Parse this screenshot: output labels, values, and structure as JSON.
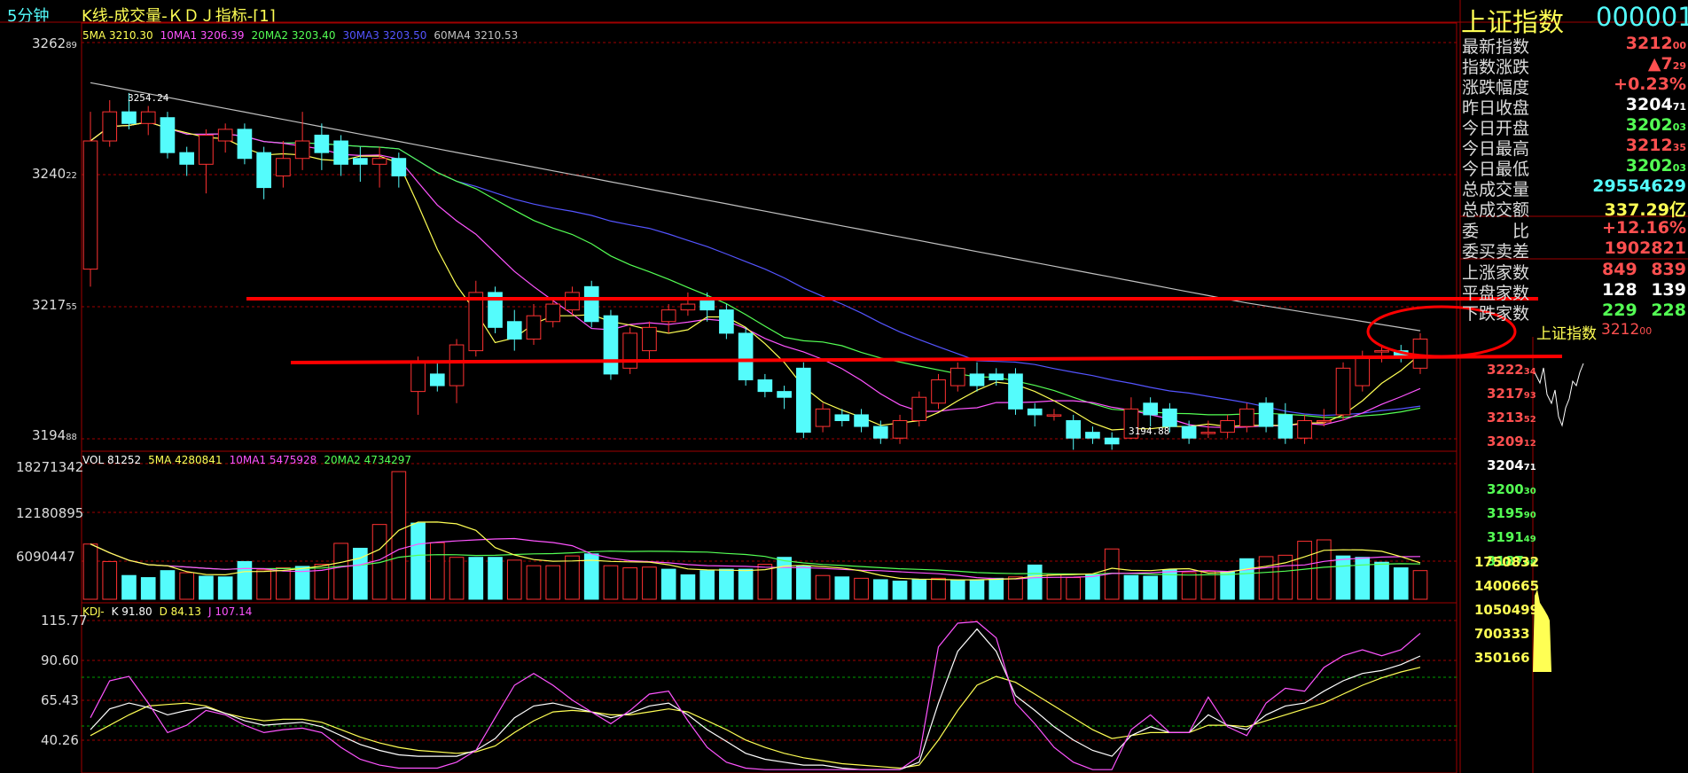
{
  "header": {
    "period": "5分钟",
    "title": "K线-成交量-ＫＤＪ指标-[1]"
  },
  "colors": {
    "up": "#ff3232",
    "down": "#54fcfc",
    "ma5": "#ffff54",
    "ma10": "#ff54ff",
    "ma20": "#54ff54",
    "ma30": "#5454ff",
    "ma60": "#c0c0c0",
    "grid": "#a00000",
    "annotation": "#ff0000"
  },
  "price_panel": {
    "legend": [
      {
        "label": "5MA 3210.30",
        "color": "#ffff54"
      },
      {
        "label": "10MA1 3206.39",
        "color": "#ff54ff"
      },
      {
        "label": "20MA2 3203.40",
        "color": "#54ff54"
      },
      {
        "label": "30MA3 3203.50",
        "color": "#5454ff"
      },
      {
        "label": "60MA4 3210.53",
        "color": "#c0c0c0"
      }
    ],
    "axis_labels": [
      {
        "main": "3262",
        "sub": "89"
      },
      {
        "main": "3240",
        "sub": "22"
      },
      {
        "main": "3217",
        "sub": "55"
      },
      {
        "main": "3194",
        "sub": "88"
      }
    ],
    "high_note": "3254.24",
    "low_note": "3194.88"
  },
  "volume_panel": {
    "legend": [
      {
        "label": "VOL 81252",
        "color": "#ffffff"
      },
      {
        "label": "5MA 4280841",
        "color": "#ffff54"
      },
      {
        "label": "10MA1 5475928",
        "color": "#ff54ff"
      },
      {
        "label": "20MA2 4734297",
        "color": "#54ff54"
      }
    ],
    "axis_labels": [
      "18271342",
      "12180895",
      "6090447"
    ]
  },
  "kdj_panel": {
    "legend": [
      {
        "label": "KDJ-",
        "color": "#ffff54"
      },
      {
        "label": "K 91.80",
        "color": "#ffffff"
      },
      {
        "label": "D 84.13",
        "color": "#ffff54"
      },
      {
        "label": "J 107.14",
        "color": "#ff54ff"
      }
    ],
    "axis_labels": [
      "115.77",
      "90.60",
      "65.43",
      "40.26"
    ]
  },
  "quote": {
    "name": "上证指数",
    "code": "000001",
    "rows": [
      {
        "label": "最新指数",
        "value": "3212",
        "sub": "00",
        "color": "#ff5050"
      },
      {
        "label": "指数涨跌",
        "value": "▲7",
        "sub": "29",
        "color": "#ff5050"
      },
      {
        "label": "涨跌幅度",
        "value": "+0.23%",
        "sub": "",
        "color": "#ff5050"
      },
      {
        "label": "昨日收盘",
        "value": "3204",
        "sub": "71",
        "color": "#ffffff"
      },
      {
        "label": "今日开盘",
        "value": "3202",
        "sub": "03",
        "color": "#54ff54"
      },
      {
        "label": "今日最高",
        "value": "3212",
        "sub": "35",
        "color": "#ff5050"
      },
      {
        "label": "今日最低",
        "value": "3202",
        "sub": "03",
        "color": "#54ff54"
      },
      {
        "label": "总成交量",
        "value": "29554629",
        "sub": "",
        "color": "#54fcfc"
      },
      {
        "label": "总成交额",
        "value": "337.29亿",
        "sub": "",
        "color": "#ffff54"
      }
    ],
    "ratio_rows": [
      {
        "label": "委　　比",
        "value": "+12.16%",
        "color": "#ff5050"
      },
      {
        "label": "委买卖差",
        "value": "1902821",
        "color": "#ff5050"
      }
    ],
    "breadth_rows": [
      {
        "label": "上涨家数",
        "v1": "849",
        "v2": "839",
        "color": "#ff5050"
      },
      {
        "label": "平盘家数",
        "v1": "128",
        "v2": "139",
        "color": "#ffffff"
      },
      {
        "label": "下跌家数",
        "v1": "229",
        "v2": "228",
        "color": "#54ff54"
      }
    ]
  },
  "mini_chart": {
    "title": "上证指数",
    "price": "3212",
    "price_sub": "00",
    "price_labels": [
      {
        "main": "3222",
        "sub": "34",
        "color": "#ff5050"
      },
      {
        "main": "3217",
        "sub": "93",
        "color": "#ff5050"
      },
      {
        "main": "3213",
        "sub": "52",
        "color": "#ff5050"
      },
      {
        "main": "3209",
        "sub": "12",
        "color": "#ff5050"
      },
      {
        "main": "3204",
        "sub": "71",
        "color": "#ffffff"
      },
      {
        "main": "3200",
        "sub": "30",
        "color": "#54ff54"
      },
      {
        "main": "3195",
        "sub": "90",
        "color": "#54ff54"
      },
      {
        "main": "3191",
        "sub": "49",
        "color": "#54ff54"
      },
      {
        "main": "3187",
        "sub": "08",
        "color": "#54ff54"
      }
    ],
    "volume_labels": [
      "1750832",
      "1400665",
      "1050499",
      "700333",
      "350166"
    ]
  },
  "chart_data": {
    "type": "candlestick",
    "price_ylim": [
      3194.88,
      3262.89
    ],
    "candles": [
      [
        3224,
        3246,
        3221,
        3251
      ],
      [
        3246,
        3251,
        3245,
        3253
      ],
      [
        3251,
        3249,
        3248,
        3254.24
      ],
      [
        3249,
        3251,
        3247,
        3252
      ],
      [
        3250,
        3244,
        3243,
        3251
      ],
      [
        3244,
        3242,
        3240,
        3245
      ],
      [
        3242,
        3247,
        3237,
        3248
      ],
      [
        3246,
        3248,
        3244,
        3249
      ],
      [
        3248,
        3243,
        3242,
        3249
      ],
      [
        3244,
        3238,
        3236,
        3245
      ],
      [
        3240,
        3243,
        3238,
        3246
      ],
      [
        3243,
        3246,
        3241,
        3251
      ],
      [
        3247,
        3244,
        3241,
        3249
      ],
      [
        3246,
        3242,
        3240,
        3247
      ],
      [
        3243,
        3242,
        3239,
        3245
      ],
      [
        3242,
        3243,
        3238,
        3245
      ],
      [
        3243,
        3240,
        3238,
        3244
      ],
      [
        3203,
        3208,
        3199,
        3209
      ],
      [
        3206,
        3204,
        3203,
        3208
      ],
      [
        3204,
        3211,
        3201,
        3212
      ],
      [
        3210,
        3220,
        3209,
        3222
      ],
      [
        3220,
        3214,
        3213,
        3221
      ],
      [
        3215,
        3212,
        3210,
        3217
      ],
      [
        3212,
        3216,
        3211,
        3218
      ],
      [
        3215,
        3218,
        3214,
        3219
      ],
      [
        3217,
        3220,
        3216,
        3221
      ],
      [
        3221,
        3215,
        3214,
        3222
      ],
      [
        3216,
        3206,
        3205,
        3217
      ],
      [
        3207,
        3213,
        3206,
        3214
      ],
      [
        3210,
        3214,
        3208,
        3215
      ],
      [
        3215,
        3217,
        3213,
        3218
      ],
      [
        3217,
        3218,
        3216,
        3220
      ],
      [
        3219,
        3217,
        3215,
        3220
      ],
      [
        3217,
        3213,
        3212,
        3218
      ],
      [
        3213,
        3205,
        3204,
        3214
      ],
      [
        3205,
        3203,
        3202,
        3206
      ],
      [
        3203,
        3202,
        3200,
        3204
      ],
      [
        3207,
        3196,
        3195,
        3208
      ],
      [
        3197,
        3200,
        3196,
        3201
      ],
      [
        3199,
        3198,
        3197,
        3200
      ],
      [
        3199,
        3197,
        3196,
        3200
      ],
      [
        3197,
        3195,
        3194,
        3198
      ],
      [
        3195,
        3198,
        3194,
        3199
      ],
      [
        3198,
        3202,
        3197,
        3203
      ],
      [
        3201,
        3205,
        3200,
        3206
      ],
      [
        3204,
        3207,
        3203,
        3208
      ],
      [
        3206,
        3204,
        3203,
        3208
      ],
      [
        3206,
        3205,
        3204,
        3207
      ],
      [
        3206,
        3200,
        3199,
        3207
      ],
      [
        3200,
        3199,
        3197,
        3201
      ],
      [
        3199,
        3199,
        3198,
        3200
      ],
      [
        3198,
        3195,
        3193,
        3199
      ],
      [
        3196,
        3195,
        3194,
        3197
      ],
      [
        3195,
        3194,
        3193,
        3196
      ],
      [
        3195,
        3200,
        3194.88,
        3202
      ],
      [
        3201,
        3199,
        3197,
        3202
      ],
      [
        3200,
        3197,
        3196,
        3201
      ],
      [
        3197,
        3195,
        3194,
        3198
      ],
      [
        3196,
        3196,
        3195,
        3198
      ],
      [
        3196,
        3198,
        3195,
        3199
      ],
      [
        3197,
        3200,
        3196,
        3201
      ],
      [
        3201,
        3197,
        3196,
        3202
      ],
      [
        3199,
        3195,
        3194,
        3201
      ],
      [
        3195,
        3198,
        3194,
        3199
      ],
      [
        3198,
        3198,
        3197,
        3200
      ],
      [
        3199,
        3207,
        3198,
        3208
      ],
      [
        3204,
        3209,
        3203,
        3210
      ],
      [
        3210,
        3210,
        3208,
        3211
      ],
      [
        3210,
        3209,
        3208,
        3211
      ],
      [
        3207,
        3212,
        3206,
        3213
      ]
    ],
    "volume_ylim": [
      0,
      18271342
    ],
    "volume": [
      [
        7.9,
        0
      ],
      [
        5.4,
        0
      ],
      [
        3.4,
        1
      ],
      [
        3.1,
        1
      ],
      [
        4.1,
        1
      ],
      [
        3.8,
        0
      ],
      [
        3.3,
        1
      ],
      [
        3.2,
        1
      ],
      [
        5.4,
        1
      ],
      [
        4.2,
        0
      ],
      [
        4.5,
        0
      ],
      [
        4.7,
        1
      ],
      [
        5.0,
        0
      ],
      [
        8.0,
        0
      ],
      [
        7.3,
        1
      ],
      [
        10.7,
        0
      ],
      [
        18.27,
        0
      ],
      [
        10.9,
        1
      ],
      [
        8.1,
        0
      ],
      [
        6.0,
        0
      ],
      [
        6.0,
        1
      ],
      [
        6.0,
        1
      ],
      [
        5.6,
        0
      ],
      [
        4.8,
        0
      ],
      [
        4.8,
        0
      ],
      [
        6.2,
        0
      ],
      [
        6.5,
        1
      ],
      [
        4.8,
        0
      ],
      [
        4.5,
        0
      ],
      [
        4.6,
        0
      ],
      [
        4.3,
        1
      ],
      [
        3.5,
        1
      ],
      [
        4.1,
        1
      ],
      [
        4.3,
        1
      ],
      [
        4.3,
        1
      ],
      [
        5.0,
        0
      ],
      [
        6.0,
        1
      ],
      [
        4.7,
        1
      ],
      [
        3.4,
        0
      ],
      [
        3.2,
        1
      ],
      [
        3.0,
        0
      ],
      [
        2.8,
        1
      ],
      [
        2.6,
        1
      ],
      [
        2.8,
        1
      ],
      [
        3.0,
        0
      ],
      [
        2.7,
        1
      ],
      [
        2.8,
        1
      ],
      [
        3.0,
        1
      ],
      [
        3.2,
        0
      ],
      [
        4.9,
        1
      ],
      [
        3.5,
        0
      ],
      [
        3.1,
        0
      ],
      [
        3.5,
        1
      ],
      [
        7.2,
        0
      ],
      [
        3.4,
        1
      ],
      [
        3.3,
        1
      ],
      [
        4.2,
        1
      ],
      [
        3.8,
        0
      ],
      [
        4.0,
        0
      ],
      [
        3.9,
        1
      ],
      [
        5.8,
        1
      ],
      [
        6.1,
        0
      ],
      [
        6.3,
        0
      ],
      [
        8.3,
        0
      ],
      [
        8.5,
        0
      ],
      [
        6.2,
        1
      ],
      [
        6.0,
        1
      ],
      [
        5.3,
        1
      ],
      [
        4.5,
        1
      ],
      [
        4.1,
        0
      ]
    ],
    "kdj_ylim": [
      15.09,
      115.77
    ],
    "k": [
      42,
      56,
      60,
      57,
      52,
      55,
      57,
      53,
      48,
      45,
      46,
      47,
      44,
      38,
      32,
      28,
      25,
      24,
      24,
      24,
      28,
      36,
      50,
      58,
      60,
      57,
      54,
      50,
      53,
      58,
      60,
      52,
      42,
      34,
      26,
      22,
      20,
      18,
      18,
      16,
      15,
      15,
      15,
      20,
      60,
      95,
      110,
      95,
      65,
      55,
      44,
      35,
      28,
      24,
      38,
      44,
      40,
      40,
      52,
      45,
      42,
      52,
      58,
      60,
      68,
      75,
      80,
      82,
      86,
      91.8
    ],
    "d": [
      38,
      45,
      52,
      58,
      59,
      60,
      58,
      53,
      50,
      48,
      49,
      49,
      47,
      42,
      37,
      33,
      30,
      28,
      27,
      26,
      27,
      31,
      40,
      48,
      54,
      55,
      54,
      52,
      52,
      54,
      56,
      54,
      48,
      42,
      35,
      30,
      26,
      23,
      21,
      19,
      18,
      17,
      16,
      18,
      35,
      55,
      72,
      78,
      74,
      66,
      58,
      50,
      42,
      36,
      38,
      40,
      40,
      40,
      45,
      45,
      44,
      48,
      52,
      56,
      60,
      66,
      72,
      77,
      81,
      84.13
    ],
    "j": [
      50,
      75,
      78,
      60,
      40,
      45,
      55,
      52,
      45,
      40,
      42,
      43,
      40,
      30,
      22,
      18,
      16,
      16,
      16,
      20,
      28,
      50,
      72,
      80,
      72,
      62,
      54,
      46,
      55,
      66,
      68,
      48,
      30,
      20,
      16,
      15,
      15,
      15,
      15,
      15,
      15,
      15,
      15,
      24,
      98,
      114,
      115,
      104,
      60,
      46,
      30,
      20,
      15,
      15,
      42,
      52,
      40,
      40,
      64,
      44,
      38,
      60,
      70,
      68,
      84,
      92,
      96,
      92,
      96,
      107.14
    ]
  }
}
